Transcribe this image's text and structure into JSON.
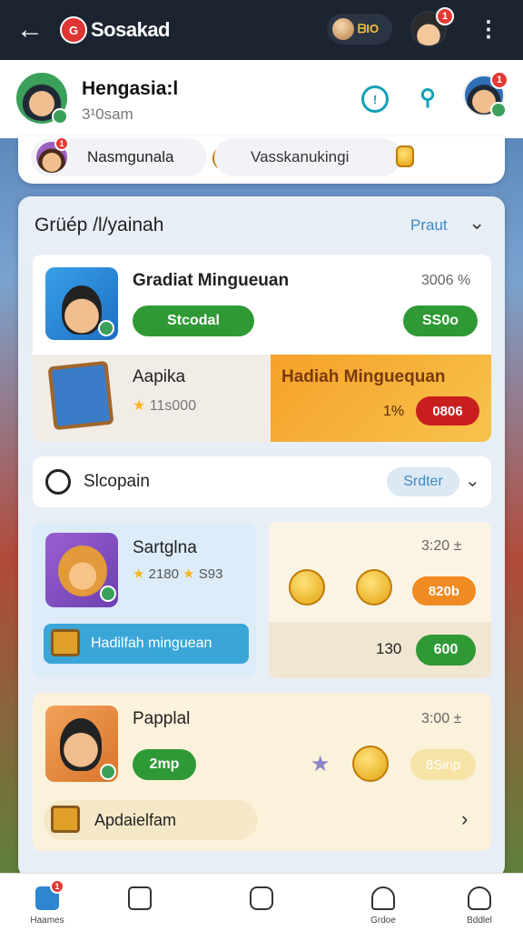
{
  "topbar": {
    "app_title": "Sosakad",
    "coin_text": "ᗷIO",
    "badge_count": "1"
  },
  "profile": {
    "name": "Hengasia:l",
    "time": "3¹0sam",
    "info_symbol": "!",
    "avatar_badge": "1"
  },
  "pills": [
    {
      "label": "Nasmgunala",
      "badge": "1"
    },
    {
      "label": "Vasskanukingi"
    }
  ],
  "section": {
    "title": "Grüép /l/yainah",
    "link": "Praut"
  },
  "featured": {
    "title": "Gradiat Mingueuan",
    "value": "3006 %",
    "primary_button": "Stcodal",
    "secondary_button": "SS0o",
    "sub_title": "Aapika",
    "sub_stars": "11s000",
    "promo_title": "Hadiah Minguequan",
    "promo_percent": "1%",
    "promo_button": "0806"
  },
  "search": {
    "label": "Slcopain",
    "sort_label": "Srdter"
  },
  "left_card": {
    "title": "Sartglna",
    "stars": "2180",
    "stars2": "S93",
    "bar_label": "Hadilfah minguean"
  },
  "right_card": {
    "value": "3:20 ±",
    "orange_button": "820b",
    "number": "130",
    "green_button": "600"
  },
  "bottom_card": {
    "title": "Papplal",
    "value": "3:00 ±",
    "green_button": "2mp",
    "faded_button": "8Sinp",
    "lower_label": "Apdaielfam"
  },
  "nav": [
    {
      "label": "Haames",
      "badge": "1"
    },
    {
      "label": ""
    },
    {
      "label": ""
    },
    {
      "label": "Grdoe"
    },
    {
      "label": "Bddlel"
    }
  ],
  "colors": {
    "topbar": "#1b2430",
    "accent_blue": "#15a0b8",
    "green": "#2f9a35",
    "red": "#c81e1e",
    "orange": "#f08a22"
  }
}
